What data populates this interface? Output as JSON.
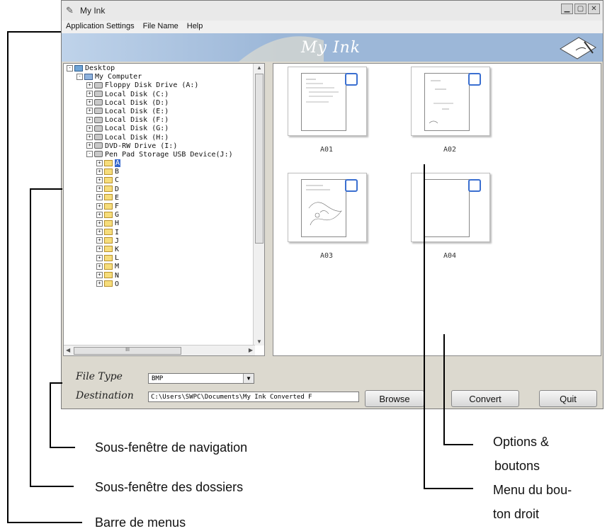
{
  "window": {
    "title": "My Ink",
    "menu": [
      "Application Settings",
      "File Name",
      "Help"
    ],
    "banner_brand": "My Ink",
    "controls": [
      "minimize",
      "maximize",
      "close"
    ]
  },
  "tree": {
    "rows": [
      {
        "label": "Desktop",
        "indent": 0,
        "icon": "desktop-icon",
        "expander": "-"
      },
      {
        "label": "My Computer",
        "indent": 1,
        "icon": "computer-icon",
        "expander": "-"
      },
      {
        "label": "Floppy Disk Drive (A:)",
        "indent": 2,
        "icon": "floppy-icon",
        "expander": "+"
      },
      {
        "label": "Local Disk (C:)",
        "indent": 2,
        "icon": "drive-icon",
        "expander": "+"
      },
      {
        "label": "Local Disk (D:)",
        "indent": 2,
        "icon": "drive-icon",
        "expander": "+"
      },
      {
        "label": "Local Disk (E:)",
        "indent": 2,
        "icon": "drive-icon",
        "expander": "+"
      },
      {
        "label": "Local Disk (F:)",
        "indent": 2,
        "icon": "drive-icon",
        "expander": "+"
      },
      {
        "label": "Local Disk (G:)",
        "indent": 2,
        "icon": "drive-icon",
        "expander": "+"
      },
      {
        "label": "Local Disk (H:)",
        "indent": 2,
        "icon": "drive-icon",
        "expander": "+"
      },
      {
        "label": "DVD-RW Drive (I:)",
        "indent": 2,
        "icon": "dvd-icon",
        "expander": "+"
      },
      {
        "label": "Pen Pad Storage USB Device(J:)",
        "indent": 2,
        "icon": "usb-drive-icon",
        "expander": "-"
      },
      {
        "label": "A",
        "indent": 3,
        "icon": "folder-icon",
        "expander": "+",
        "selected": true
      },
      {
        "label": "B",
        "indent": 3,
        "icon": "folder-icon",
        "expander": "+"
      },
      {
        "label": "C",
        "indent": 3,
        "icon": "folder-icon",
        "expander": "+"
      },
      {
        "label": "D",
        "indent": 3,
        "icon": "folder-icon",
        "expander": "+"
      },
      {
        "label": "E",
        "indent": 3,
        "icon": "folder-icon",
        "expander": "+"
      },
      {
        "label": "F",
        "indent": 3,
        "icon": "folder-icon",
        "expander": "+"
      },
      {
        "label": "G",
        "indent": 3,
        "icon": "folder-icon",
        "expander": "+"
      },
      {
        "label": "H",
        "indent": 3,
        "icon": "folder-icon",
        "expander": "+"
      },
      {
        "label": "I",
        "indent": 3,
        "icon": "folder-icon",
        "expander": "+"
      },
      {
        "label": "J",
        "indent": 3,
        "icon": "folder-icon",
        "expander": "+"
      },
      {
        "label": "K",
        "indent": 3,
        "icon": "folder-icon",
        "expander": "+"
      },
      {
        "label": "L",
        "indent": 3,
        "icon": "folder-icon",
        "expander": "+"
      },
      {
        "label": "M",
        "indent": 3,
        "icon": "folder-icon",
        "expander": "+"
      },
      {
        "label": "N",
        "indent": 3,
        "icon": "folder-icon",
        "expander": "+"
      },
      {
        "label": "O",
        "indent": 3,
        "icon": "folder-icon",
        "expander": "+"
      }
    ],
    "hscroll_thumb": "III"
  },
  "thumbnails": [
    {
      "caption": "A01",
      "checked": false
    },
    {
      "caption": "A02",
      "checked": false
    },
    {
      "caption": "A03",
      "checked": false
    },
    {
      "caption": "A04",
      "checked": false
    }
  ],
  "options": {
    "file_type_label": "File Type",
    "file_type_value": "BMP",
    "destination_label": "Destination",
    "destination_value": "C:\\Users\\SWPC\\Documents\\My Ink Converted F",
    "browse_label": "Browse",
    "convert_label": "Convert",
    "quit_label": "Quit"
  },
  "callouts": {
    "navigation": "Sous-fenêtre de navigation",
    "folders": "Sous-fenêtre des dossiers",
    "menubar": "Barre de menus",
    "options_1": "Options &",
    "options_2": "boutons",
    "rightclick_1": "Menu du bou-",
    "rightclick_2": "ton droit"
  }
}
